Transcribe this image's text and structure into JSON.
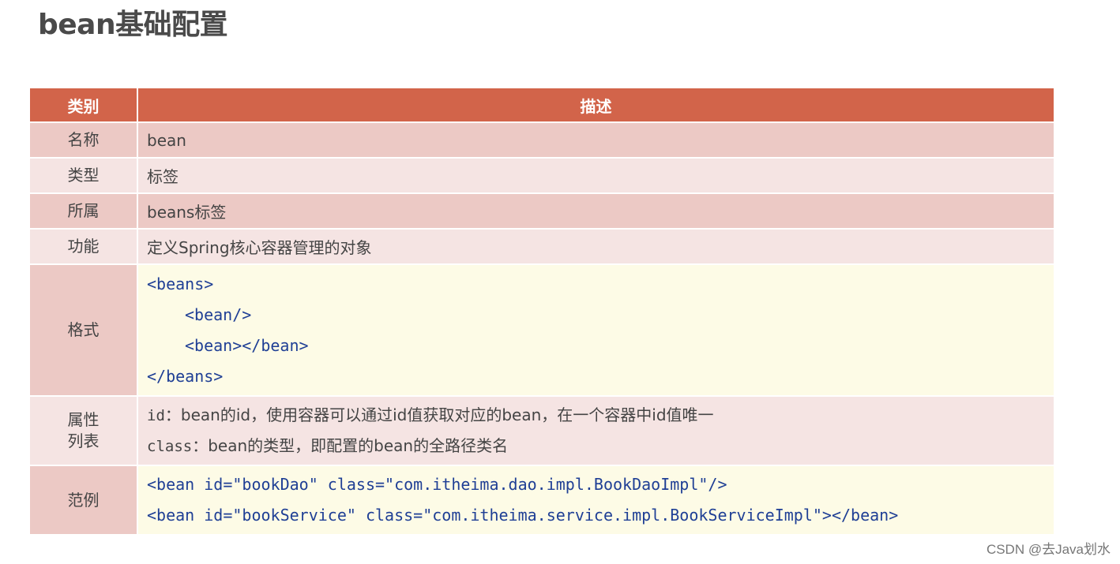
{
  "title": "bean基础配置",
  "table": {
    "headers": [
      "类别",
      "描述"
    ],
    "rows": {
      "name": {
        "label": "名称",
        "value": "bean"
      },
      "type": {
        "label": "类型",
        "value": "标签"
      },
      "belongs": {
        "label": "所属",
        "value": "beans标签"
      },
      "function": {
        "label": "功能",
        "value": "定义Spring核心容器管理的对象"
      },
      "format": {
        "label": "格式",
        "lines": [
          "<beans>",
          "<bean/>",
          "<bean></bean>",
          "</beans>"
        ]
      },
      "attributes": {
        "label_line1": "属性",
        "label_line2": "列表",
        "items": [
          {
            "name": "id",
            "sep": "：",
            "desc": "bean的id，使用容器可以通过id值获取对应的bean，在一个容器中id值唯一"
          },
          {
            "name": "class",
            "sep": "：",
            "desc": "bean的类型，即配置的bean的全路径类名"
          }
        ]
      },
      "example": {
        "label": "范例",
        "lines": [
          "<bean id=\"bookDao\" class=\"com.itheima.dao.impl.BookDaoImpl\"/>",
          "<bean id=\"bookService\" class=\"com.itheima.service.impl.BookServiceImpl\"></bean>"
        ]
      }
    }
  },
  "watermark": "CSDN @去Java划水",
  "colors": {
    "header": "#d2644a",
    "row_dark": "#ecc9c5",
    "row_light": "#f5e4e3",
    "code_bg": "#fdfbe6",
    "keyword": "#1f3f95"
  }
}
